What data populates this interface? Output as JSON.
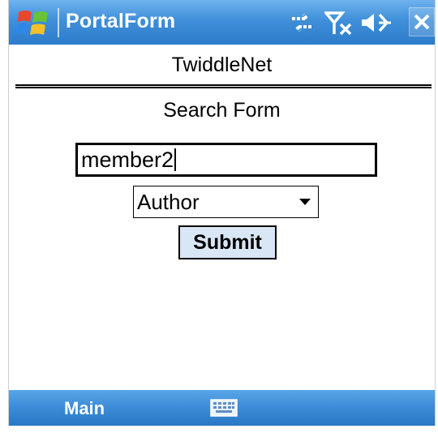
{
  "titlebar": {
    "app_title": "PortalForm",
    "icons": [
      "windows-start-icon",
      "connectivity-icon",
      "no-signal-icon",
      "volume-icon",
      "close-icon"
    ]
  },
  "page": {
    "heading": "TwiddleNet",
    "form_title": "Search Form"
  },
  "search": {
    "value": "member2"
  },
  "filter": {
    "selected": "Author"
  },
  "submit_label": "Submit",
  "menubar": {
    "left_softkey": "Main",
    "center_icon": "keyboard-icon"
  },
  "colors": {
    "titlebar_blue": "#3f8fd9",
    "menubar_blue": "#3b8bd6",
    "button_fill": "#d9e6f5"
  }
}
